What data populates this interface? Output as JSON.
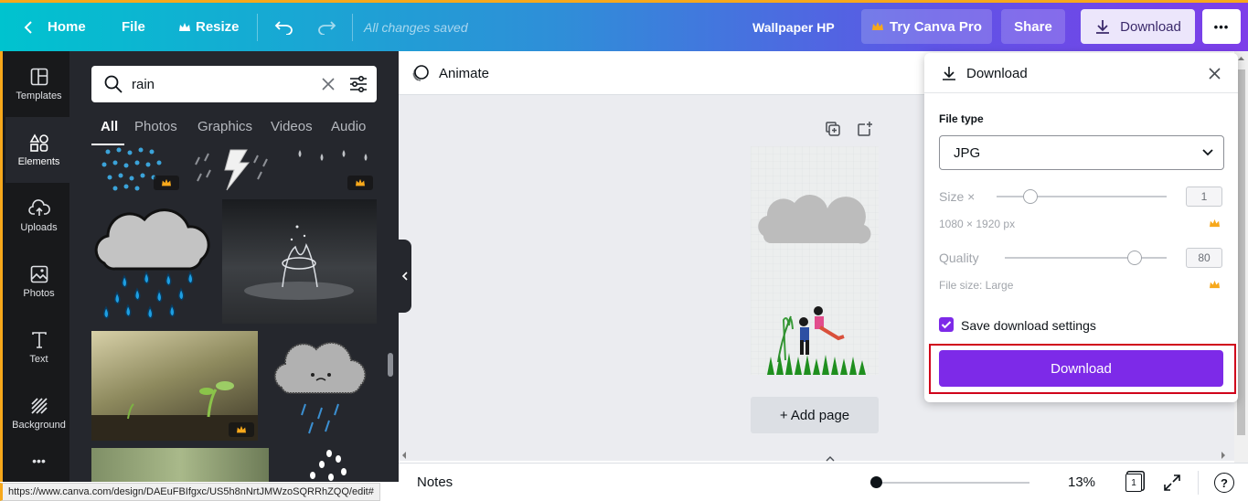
{
  "topbar": {
    "home_label": "Home",
    "file_label": "File",
    "resize_label": "Resize",
    "save_status": "All changes saved",
    "doc_title": "Wallpaper HP",
    "try_pro_label": "Try Canva Pro",
    "share_label": "Share",
    "download_label": "Download",
    "more_label": "•••"
  },
  "rail": {
    "items": [
      {
        "label": "Templates",
        "icon": "templates-icon"
      },
      {
        "label": "Elements",
        "icon": "elements-icon"
      },
      {
        "label": "Uploads",
        "icon": "uploads-icon"
      },
      {
        "label": "Photos",
        "icon": "photos-icon"
      },
      {
        "label": "Text",
        "icon": "text-icon"
      },
      {
        "label": "Background",
        "icon": "background-icon"
      },
      {
        "label": "•••",
        "icon": "more-icon"
      }
    ]
  },
  "panel": {
    "search_value": "rain",
    "tabs": [
      "All",
      "Photos",
      "Graphics",
      "Videos",
      "Audio"
    ]
  },
  "editor": {
    "animate_label": "Animate",
    "add_page_label": "+ Add page"
  },
  "bottombar": {
    "notes_label": "Notes",
    "zoom_label": "13%",
    "page_count": "1",
    "zoom_fraction": 0.0,
    "help_label": "?"
  },
  "status_url": "https://www.canva.com/design/DAEuFBIfgxc/US5h8nNrtJMWzoSQRRhZQQ/edit#",
  "download_panel": {
    "title": "Download",
    "file_type_label": "File type",
    "file_type_value": "JPG",
    "size_label": "Size ×",
    "size_value": "1",
    "size_fraction": 0.2,
    "dimensions": "1080 × 1920 px",
    "quality_label": "Quality",
    "quality_value": "80",
    "quality_fraction": 0.8,
    "file_size": "File size: Large",
    "save_settings_label": "Save download settings",
    "download_button_label": "Download"
  },
  "colors": {
    "accent_purple": "#7d2ae8",
    "highlight_red": "#d0021b",
    "pro_crown": "#f7a81b"
  }
}
